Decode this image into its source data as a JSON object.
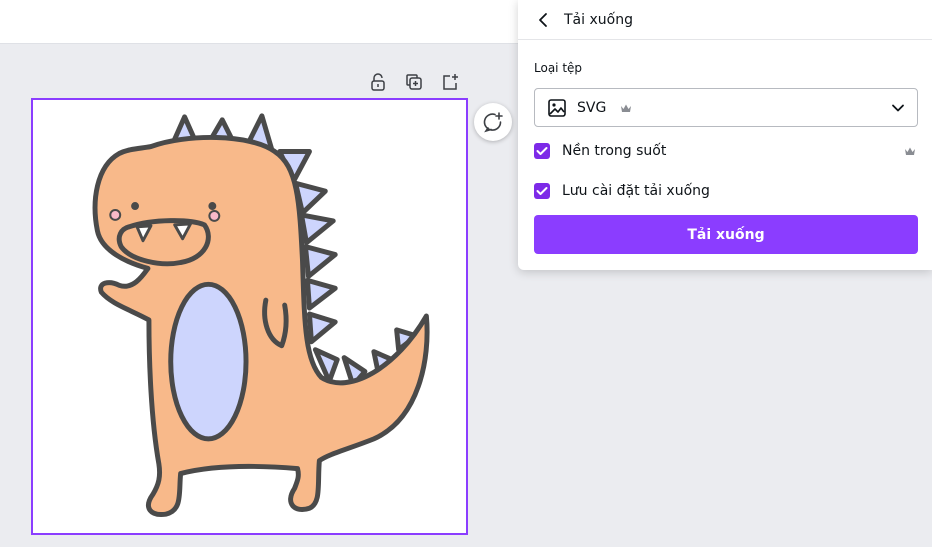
{
  "panel": {
    "title": "Tải xuống",
    "file_type_label": "Loại tệp",
    "file_type_value": "SVG",
    "transparent_bg_label": "Nền trong suốt",
    "save_settings_label": "Lưu cài đặt tải xuống",
    "download_button": "Tải xuống",
    "transparent_bg_checked": true,
    "save_settings_checked": true
  },
  "colors": {
    "accent": "#8b3dff",
    "checkbox": "#7d2ae8",
    "dino_body": "#f8b98a",
    "dino_belly": "#cdd5fd",
    "outline": "#4a4a4a"
  },
  "icons": [
    "lock-icon",
    "duplicate-icon",
    "add-page-icon",
    "add-comment-icon",
    "back-chevron-icon",
    "image-file-icon",
    "crown-icon",
    "chevron-down-icon",
    "check-icon"
  ]
}
